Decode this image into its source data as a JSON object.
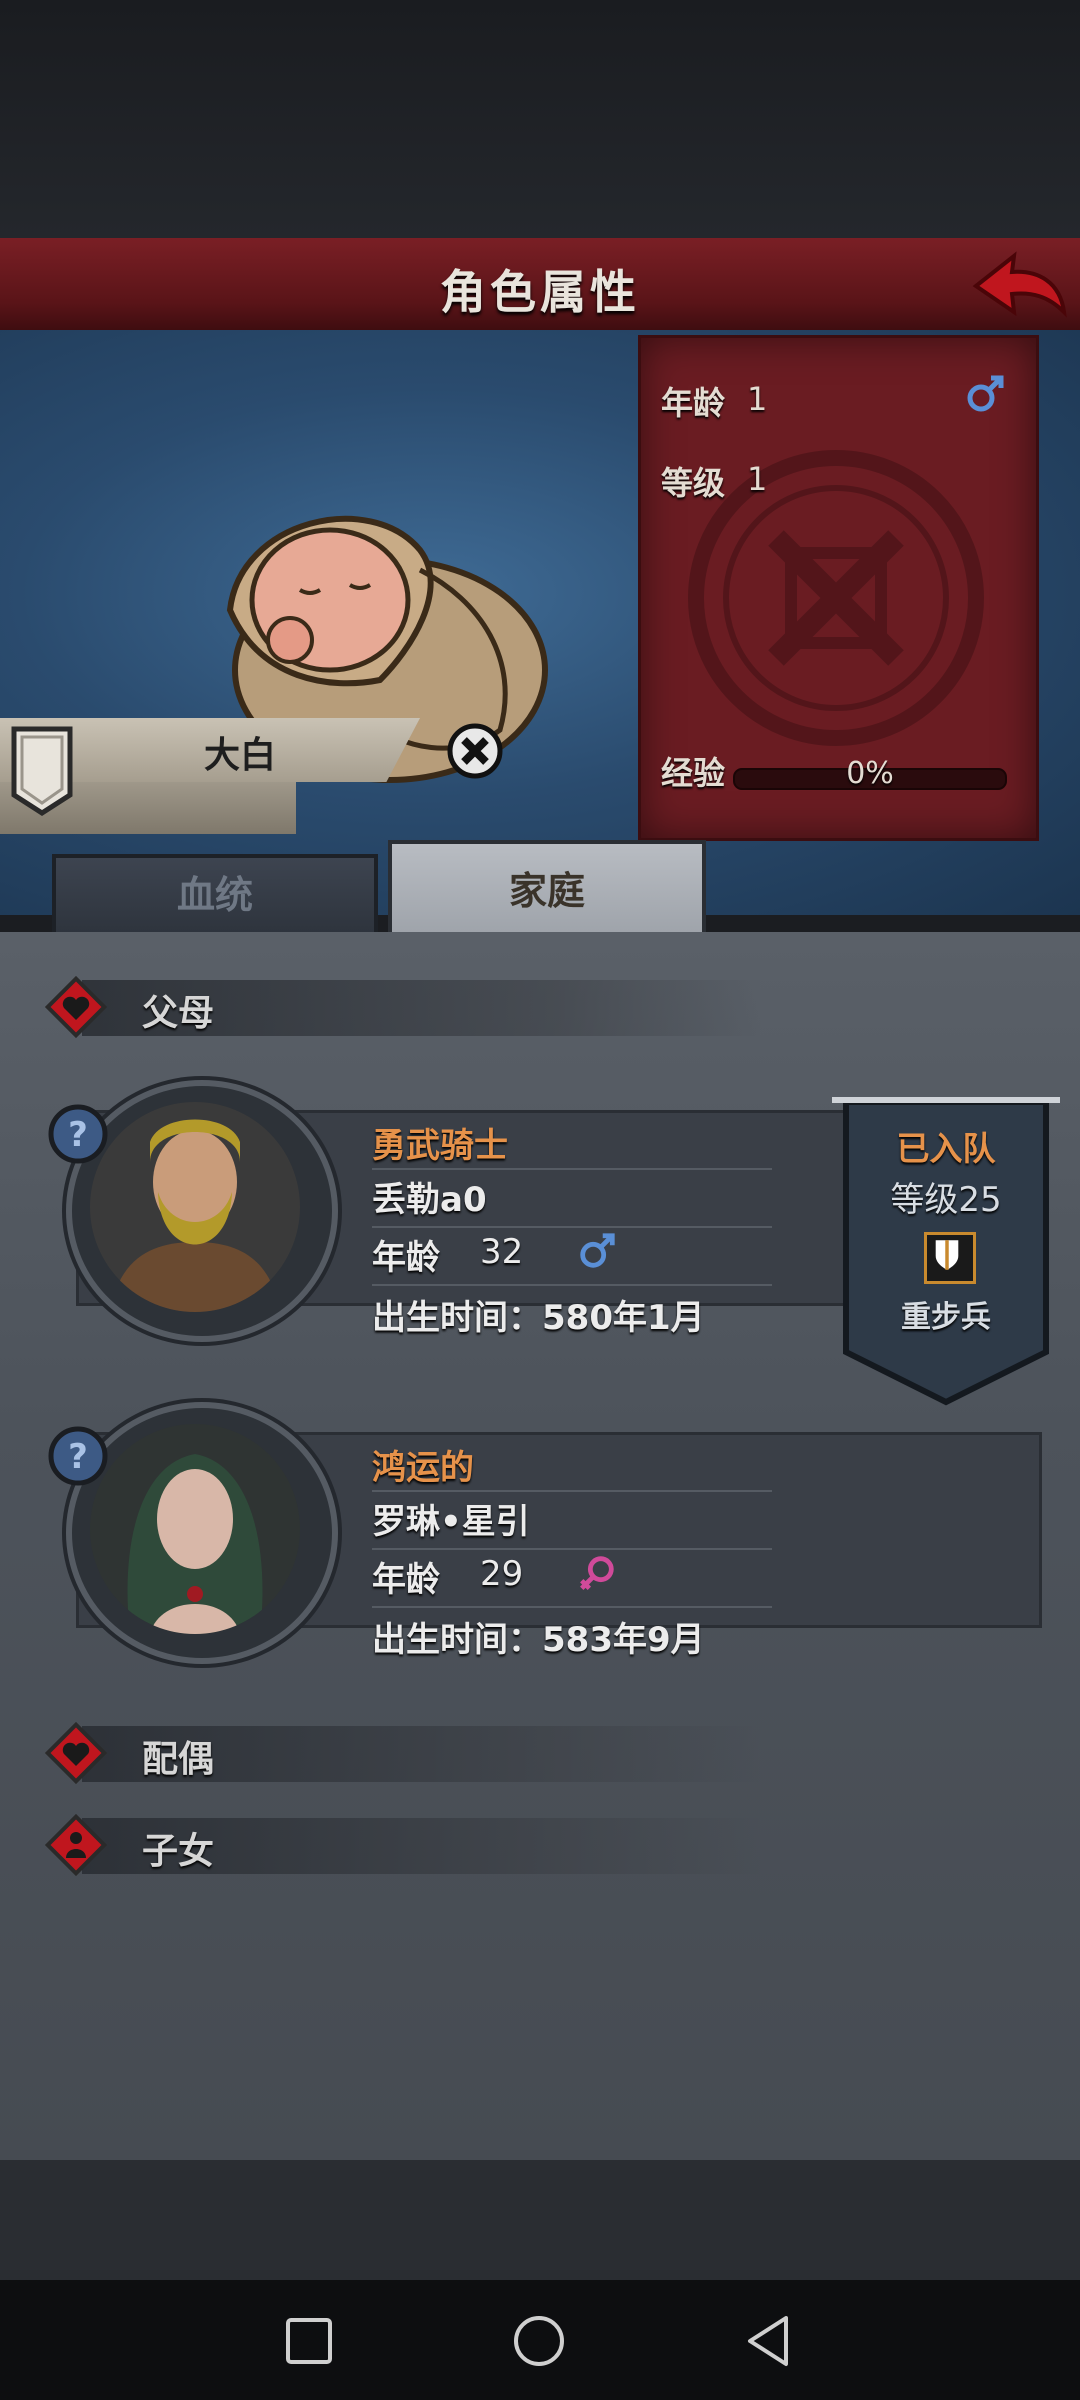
{
  "header": {
    "title": "角色属性"
  },
  "character": {
    "name": "大白",
    "age_label": "年龄",
    "age": "1",
    "level_label": "等级",
    "level": "1",
    "exp_label": "经验",
    "exp_text": "0%",
    "exp_progress": 0
  },
  "tabs": [
    {
      "label": "血统",
      "active": false
    },
    {
      "label": "家庭",
      "active": true
    }
  ],
  "sections": {
    "parents": "父母",
    "spouse": "配偶",
    "children": "子女"
  },
  "parents": [
    {
      "title": "勇武骑士",
      "name": "丢勒a0",
      "age_label": "年龄",
      "age": "32",
      "gender": "male",
      "birth": "出生时间：580年1月"
    },
    {
      "title": "鸿运的",
      "name": "罗琳•星引",
      "age_label": "年龄",
      "age": "29",
      "gender": "female",
      "birth": "出生时间：583年9月"
    }
  ],
  "team": {
    "status": "已入队",
    "level": "等级25",
    "class": "重步兵"
  },
  "colors": {
    "accent_orange": "#e6924a",
    "header_red": "#6a1c22",
    "male_blue": "#5a8fd6",
    "female_pink": "#d04a9a"
  }
}
